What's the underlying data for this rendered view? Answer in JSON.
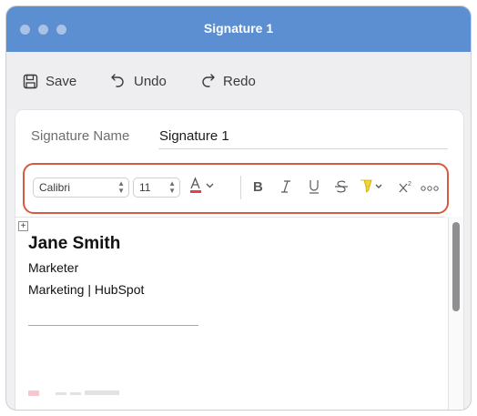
{
  "window": {
    "title": "Signature 1",
    "title_color": "#5b8fd2"
  },
  "toolbar": {
    "save_label": "Save",
    "undo_label": "Undo",
    "redo_label": "Redo",
    "icons": [
      "save-icon",
      "undo-icon",
      "redo-icon"
    ]
  },
  "signature_name": {
    "label": "Signature Name",
    "value": "Signature 1"
  },
  "format_bar": {
    "font": "Calibri",
    "size": "11",
    "highlight_border": "#d9593f",
    "font_color": "#e0424a",
    "highlight_color": "#f2d33a",
    "icons": [
      "font-color-icon",
      "bold-icon",
      "italic-icon",
      "underline-icon",
      "strikethrough-icon",
      "highlight-icon",
      "superscript-icon",
      "more-icon"
    ]
  },
  "editor": {
    "name": "Jane Smith",
    "title": "Marketer",
    "company": "Marketing | HubSpot"
  }
}
